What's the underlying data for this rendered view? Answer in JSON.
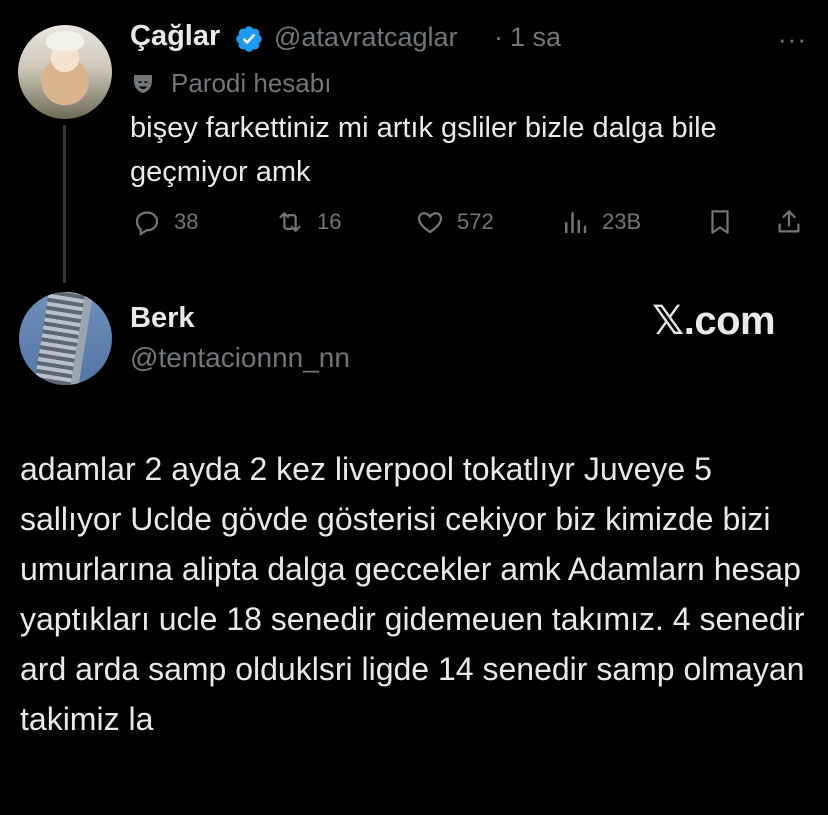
{
  "tweet1": {
    "author_name": "Çağlar",
    "handle": "@atavratcaglar",
    "separator": "·",
    "time": "1 sa",
    "more_label": "···",
    "parody_label": "Parodi hesabı",
    "text": "bişey farkettiniz mi artık gsliler bizle dalga bile geçmiyor amk",
    "stats": {
      "replies": "38",
      "reposts": "16",
      "likes": "572",
      "views": "23B"
    },
    "icons": [
      "verified-badge-icon",
      "parody-mask-icon",
      "more-icon",
      "reply-icon",
      "repost-icon",
      "like-icon",
      "views-icon",
      "bookmark-icon",
      "share-icon"
    ],
    "accent": "#1d9bf0"
  },
  "tweet2": {
    "author_name": "Berk",
    "handle": "@tentacionnn_nn",
    "watermark": "𝕏.com",
    "text": "adamlar 2 ayda 2 kez liverpool tokatlıyr Juveye 5 sallıyor Uclde gövde gösterisi cekiyor biz kimizde bizi umurlarına alipta dalga geccekler amk Adamlarn hesap yaptıkları ucle 18 senedir gidemeuen takımız. 4 senedir ard arda samp olduklsri ligde 14 senedir samp olmayan takimiz la"
  },
  "colors": {
    "background": "#000000",
    "text_primary": "#e7e9ea",
    "text_secondary": "#71767b",
    "thread_line": "#333639"
  }
}
